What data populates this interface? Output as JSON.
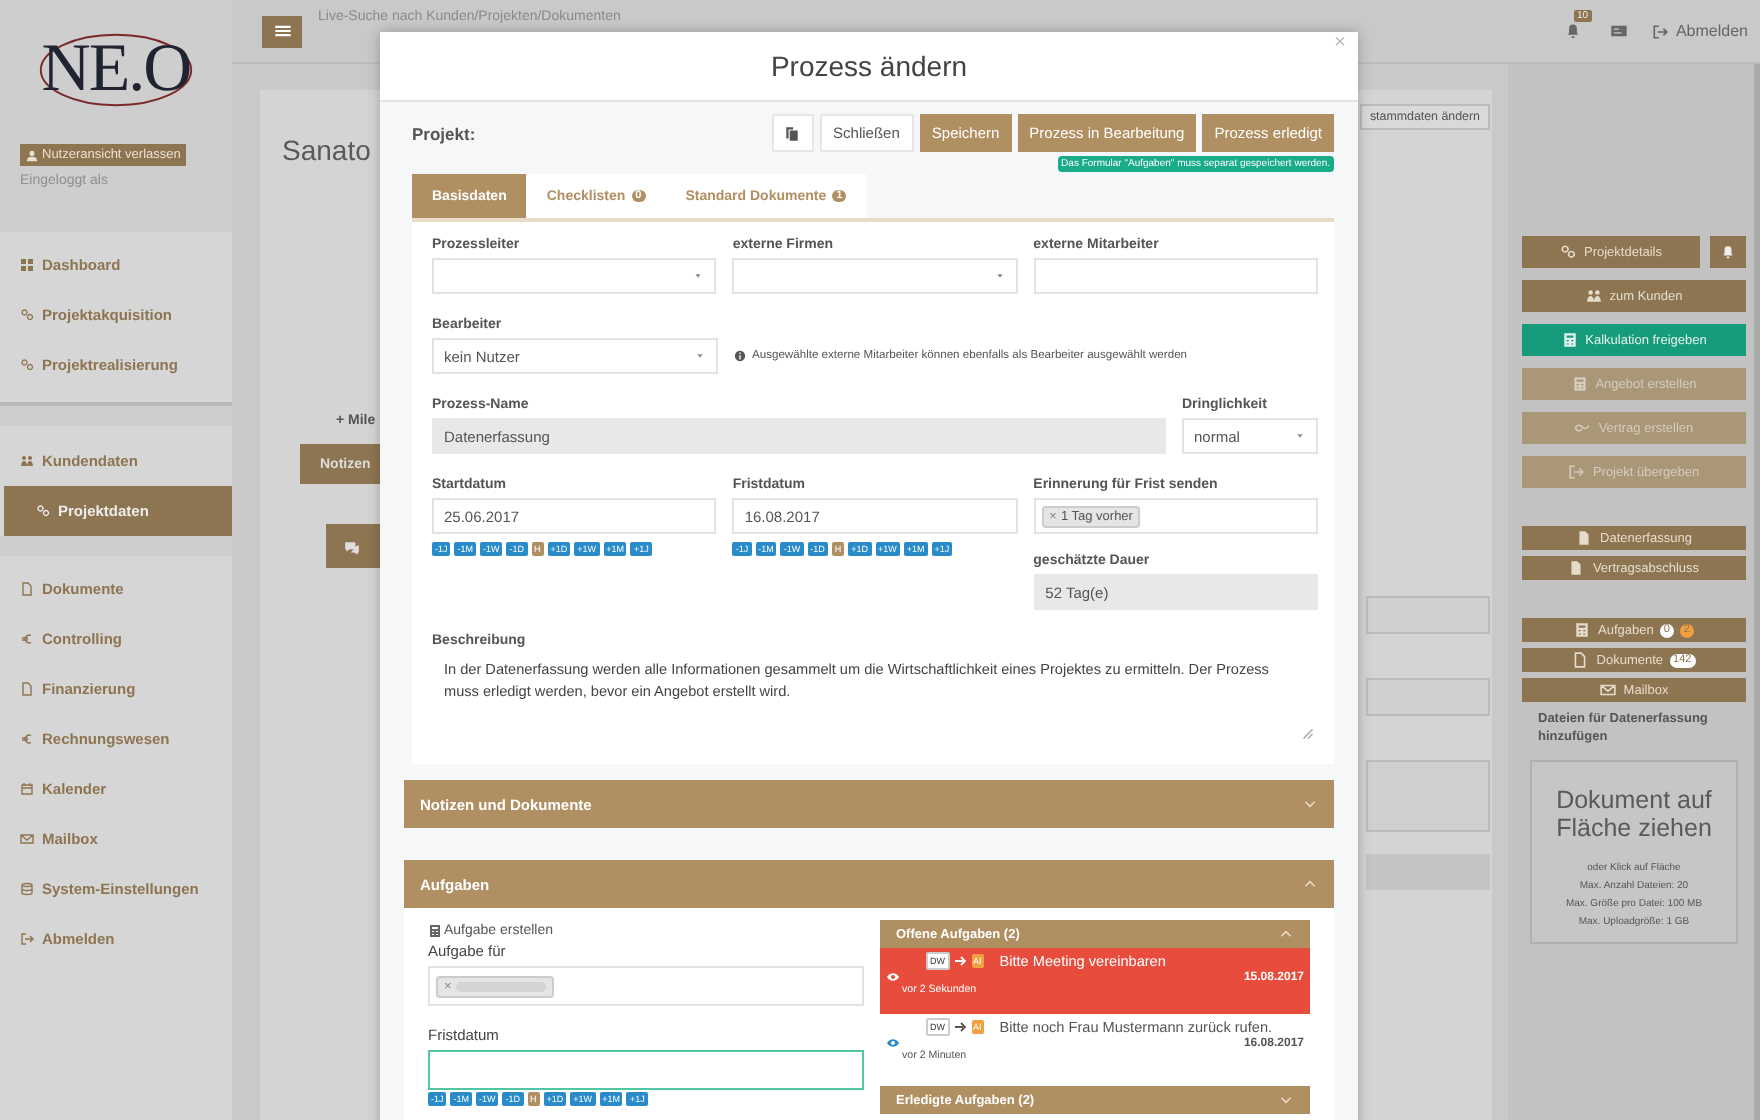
{
  "sidebar": {
    "logo": "NE.O",
    "exit_view": "Nutzeransicht verlassen",
    "logged_in": "Eingeloggt als",
    "groups": [
      [
        {
          "label": "Dashboard",
          "selected": false
        },
        {
          "label": "Projektakquisition",
          "selected": false
        },
        {
          "label": "Projektrealisierung",
          "selected": false
        }
      ],
      [
        {
          "label": "Kundendaten",
          "selected": false
        },
        {
          "label": "Projektdaten",
          "selected": true
        }
      ],
      [
        {
          "label": "Dokumente",
          "selected": false
        },
        {
          "label": "Controlling",
          "selected": false
        },
        {
          "label": "Finanzierung",
          "selected": false
        },
        {
          "label": "Rechnungswesen",
          "selected": false
        },
        {
          "label": "Kalender",
          "selected": false
        },
        {
          "label": "Mailbox",
          "selected": false
        },
        {
          "label": "System-Einstellungen",
          "selected": false
        },
        {
          "label": "Abmelden",
          "selected": false
        }
      ]
    ]
  },
  "topbar": {
    "search": {
      "placeholder": "Live-Suche nach Kunden/Projekten/Dokumenten"
    },
    "notifications": "10",
    "logout": "Abmelden"
  },
  "background": {
    "title": "Sanato",
    "milestone": "+ Mile",
    "notes_tab": "Notizen",
    "edit_master": "stammdaten ändern"
  },
  "right_panel": {
    "actions": [
      {
        "label": "Projektdetails",
        "kind": "normal"
      },
      {
        "label": "zum Kunden",
        "kind": "normal"
      },
      {
        "label": "Kalkulation freigeben",
        "kind": "accent"
      },
      {
        "label": "Angebot erstellen",
        "kind": "disabled"
      },
      {
        "label": "Vertrag erstellen",
        "kind": "disabled"
      },
      {
        "label": "Projekt übergeben",
        "kind": "disabled"
      }
    ],
    "documents": [
      {
        "label": "Datenerfassung"
      },
      {
        "label": "Vertragsabschluss"
      }
    ],
    "links": [
      {
        "label": "Aufgaben",
        "badges": [
          {
            "text": "0",
            "color": "#ffffff"
          },
          {
            "text": "2",
            "color": "#f0a040"
          }
        ]
      },
      {
        "label": "Dokumente",
        "badges": [
          {
            "text": "142",
            "color": "#ffffff"
          }
        ]
      },
      {
        "label": "Mailbox"
      }
    ],
    "upload_title": "Dateien für Datenerfassung hinzufügen",
    "dropzone": {
      "title": "Dokument auf Fläche ziehen",
      "lines": [
        "oder Klick auf Fläche",
        "Max. Anzahl Dateien: 20",
        "Max. Größe pro Datei: 100 MB",
        "Max. Uploadgröße: 1 GB"
      ]
    }
  },
  "modal": {
    "title": "Prozess ändern",
    "close": "×",
    "project_label": "Projekt:",
    "toolbar": [
      {
        "label": "Schließen",
        "kind": "plain"
      },
      {
        "label": "Speichern",
        "kind": "brown"
      },
      {
        "label": "Prozess in Bearbeitung",
        "kind": "brown"
      },
      {
        "label": "Prozess erledigt",
        "kind": "brown"
      }
    ],
    "hint": "Das Formular \"Aufgaben\" muss separat gespeichert werden.",
    "tabs": [
      {
        "label": "Basisdaten",
        "selected": true
      },
      {
        "label": "Checklisten",
        "badge": "0",
        "selected": false
      },
      {
        "label": "Standard Dokumente",
        "badge": "1",
        "selected": false
      }
    ],
    "form": {
      "process_lead": {
        "label": "Prozessleiter"
      },
      "external_companies": {
        "label": "externe Firmen"
      },
      "external_staff": {
        "label": "externe Mitarbeiter"
      },
      "assignee": {
        "label": "Bearbeiter",
        "value": "kein Nutzer"
      },
      "assignee_info": "Ausgewählte externe Mitarbeiter können ebenfalls als Bearbeiter ausgewählt werden",
      "process_name": {
        "label": "Prozess-Name",
        "value": "Datenerfassung"
      },
      "urgency": {
        "label": "Dringlichkeit",
        "value": "normal"
      },
      "start_date": {
        "label": "Startdatum",
        "value": "25.06.2017",
        "shortcuts": [
          {
            "label": "-1J",
            "kind": "shift"
          },
          {
            "label": "-1M",
            "kind": "shift"
          },
          {
            "label": "-1W",
            "kind": "shift"
          },
          {
            "label": "-1D",
            "kind": "shift"
          },
          {
            "label": "H",
            "kind": "today"
          },
          {
            "label": "+1D",
            "kind": "shift"
          },
          {
            "label": "+1W",
            "kind": "shift"
          },
          {
            "label": "+1M",
            "kind": "shift"
          },
          {
            "label": "+1J",
            "kind": "shift"
          }
        ]
      },
      "due_date": {
        "label": "Fristdatum",
        "value": "16.08.2017",
        "shortcuts": [
          {
            "label": "-1J",
            "kind": "shift"
          },
          {
            "label": "-1M",
            "kind": "shift"
          },
          {
            "label": "-1W",
            "kind": "shift"
          },
          {
            "label": "-1D",
            "kind": "shift"
          },
          {
            "label": "H",
            "kind": "today"
          },
          {
            "label": "+1D",
            "kind": "shift"
          },
          {
            "label": "+1W",
            "kind": "shift"
          },
          {
            "label": "+1M",
            "kind": "shift"
          },
          {
            "label": "+1J",
            "kind": "shift"
          }
        ]
      },
      "reminder": {
        "label": "Erinnerung für Frist senden",
        "tags": [
          {
            "remove": "×",
            "label": "1 Tag vorher"
          }
        ]
      },
      "duration": {
        "label": "geschätzte Dauer",
        "value": "52 Tag(e)"
      },
      "description": {
        "label": "Beschreibung",
        "value": "In der Datenerfassung werden alle Informationen gesammelt um die Wirtschaftlichkeit eines Projektes zu ermitteln. Der Prozess muss erledigt werden, bevor ein Angebot erstellt wird."
      }
    },
    "sections": [
      {
        "title": "Notizen und Dokumente",
        "kind": "notes",
        "expanded": false
      },
      {
        "title": "Aufgaben",
        "kind": "tasks",
        "expanded": true
      }
    ],
    "tasks": {
      "create_label": "Aufgabe erstellen",
      "assign": {
        "label": "Aufgabe für",
        "tags": [
          {
            "remove": "×"
          }
        ]
      },
      "due": {
        "label": "Fristdatum",
        "focused": true,
        "shortcuts": [
          {
            "label": "-1J",
            "kind": "shift"
          },
          {
            "label": "-1M",
            "kind": "shift"
          },
          {
            "label": "-1W",
            "kind": "shift"
          },
          {
            "label": "-1D",
            "kind": "shift"
          },
          {
            "label": "H",
            "kind": "today"
          },
          {
            "label": "+1D",
            "kind": "shift"
          },
          {
            "label": "+1W",
            "kind": "shift"
          },
          {
            "label": "+1M",
            "kind": "shift"
          },
          {
            "label": "+1J",
            "kind": "shift"
          }
        ]
      },
      "open": {
        "title": "Offene Aufgaben (2)",
        "expanded": true,
        "items": [
          {
            "from": "DW",
            "to": "AI",
            "text": "Bitte Meeting vereinbaren",
            "date": "15.08.2017",
            "age": "vor 2 Sekunden",
            "highlighted": true
          },
          {
            "from": "DW",
            "to": "AI",
            "text": "Bitte noch Frau Mustermann zurück rufen.",
            "date": "16.08.2017",
            "age": "vor 2 Minuten",
            "highlighted": false
          }
        ]
      },
      "done": {
        "title": "Erledigte Aufgaben (2)",
        "expanded": false
      }
    }
  }
}
